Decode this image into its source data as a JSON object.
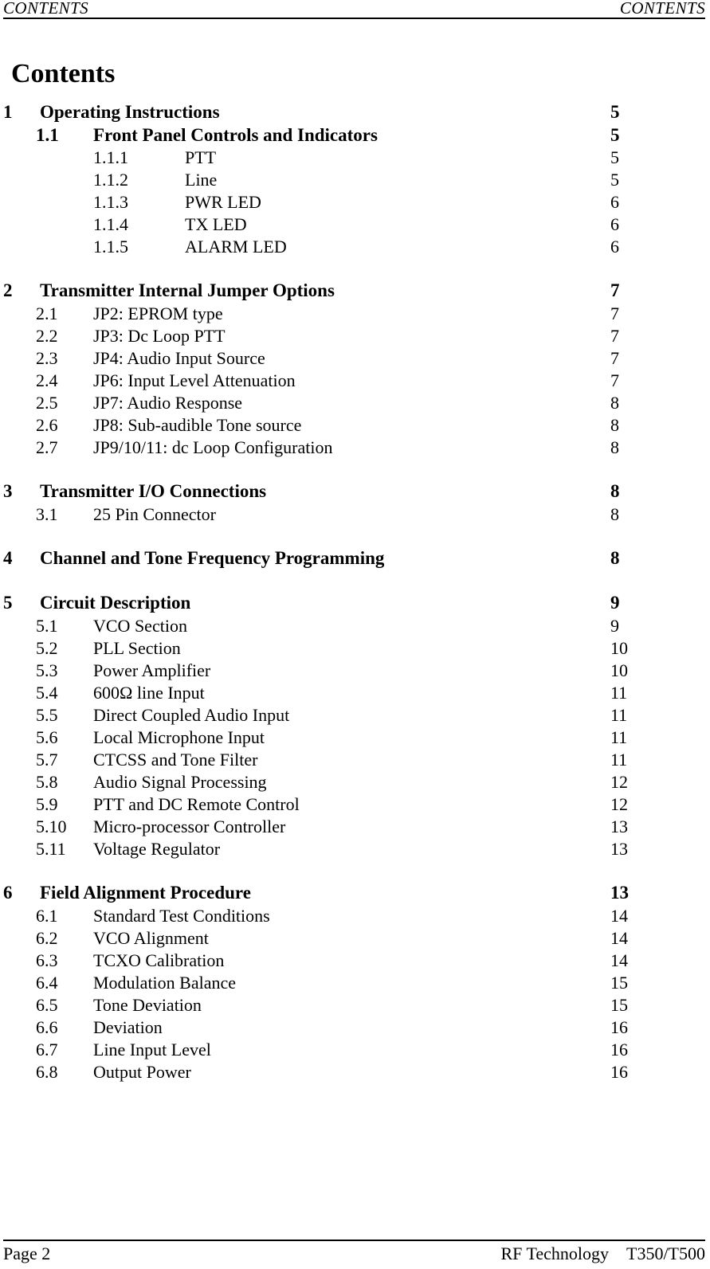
{
  "header": {
    "left": "CONTENTS",
    "right": "CONTENTS"
  },
  "title": "Contents",
  "toc": {
    "groups": [
      {
        "entries": [
          {
            "level": 1,
            "bold": true,
            "num": "1",
            "label": "Operating Instructions",
            "page": "5"
          },
          {
            "level": 2,
            "bold": true,
            "num": "1.1",
            "label": "Front Panel Controls and Indicators",
            "page": "5"
          },
          {
            "level": 3,
            "bold": false,
            "num": "1.1.1",
            "label": "PTT",
            "page": "5"
          },
          {
            "level": 3,
            "bold": false,
            "num": "1.1.2",
            "label": "Line",
            "page": "5"
          },
          {
            "level": 3,
            "bold": false,
            "num": "1.1.3",
            "label": "PWR LED",
            "page": "6"
          },
          {
            "level": 3,
            "bold": false,
            "num": "1.1.4",
            "label": "TX LED",
            "page": "6"
          },
          {
            "level": 3,
            "bold": false,
            "num": "1.1.5",
            "label": "ALARM LED",
            "page": "6"
          }
        ]
      },
      {
        "entries": [
          {
            "level": 1,
            "bold": true,
            "num": "2",
            "label": "Transmitter Internal Jumper Options",
            "page": "7"
          },
          {
            "level": 2,
            "bold": false,
            "num": "2.1",
            "label": "JP2:  EPROM type",
            "page": "7"
          },
          {
            "level": 2,
            "bold": false,
            "num": "2.2",
            "label": "JP3:  Dc Loop PTT",
            "page": "7"
          },
          {
            "level": 2,
            "bold": false,
            "num": "2.3",
            "label": "JP4:  Audio Input Source",
            "page": "7"
          },
          {
            "level": 2,
            "bold": false,
            "num": "2.4",
            "label": "JP6:  Input Level Attenuation",
            "page": "7"
          },
          {
            "level": 2,
            "bold": false,
            "num": "2.5",
            "label": "JP7:  Audio Response",
            "page": "8"
          },
          {
            "level": 2,
            "bold": false,
            "num": "2.6",
            "label": "JP8:  Sub-audible Tone source",
            "page": "8"
          },
          {
            "level": 2,
            "bold": false,
            "num": "2.7",
            "label": "JP9/10/11:  dc Loop Configuration",
            "page": "8"
          }
        ]
      },
      {
        "entries": [
          {
            "level": 1,
            "bold": true,
            "num": "3",
            "label": "Transmitter I/O Connections",
            "page": "8"
          },
          {
            "level": 2,
            "bold": false,
            "num": "3.1",
            "label": "25 Pin Connector",
            "page": "8"
          }
        ]
      },
      {
        "entries": [
          {
            "level": 1,
            "bold": true,
            "num": "4",
            "label": "Channel and Tone Frequency Programming",
            "page": "8"
          }
        ]
      },
      {
        "entries": [
          {
            "level": 1,
            "bold": true,
            "num": "5",
            "label": "Circuit Description",
            "page": "9"
          },
          {
            "level": 2,
            "bold": false,
            "num": "5.1",
            "label": "VCO Section",
            "page": "9"
          },
          {
            "level": 2,
            "bold": false,
            "num": "5.2",
            "label": "PLL Section",
            "page": "10"
          },
          {
            "level": 2,
            "bold": false,
            "num": "5.3",
            "label": "Power Amplifier",
            "page": "10"
          },
          {
            "level": 2,
            "bold": false,
            "num": "5.4",
            "label": "600Ω line Input",
            "page": "11"
          },
          {
            "level": 2,
            "bold": false,
            "num": "5.5",
            "label": "Direct Coupled Audio Input",
            "page": "11"
          },
          {
            "level": 2,
            "bold": false,
            "num": "5.6",
            "label": "Local Microphone Input",
            "page": "11"
          },
          {
            "level": 2,
            "bold": false,
            "num": "5.7",
            "label": "CTCSS and Tone Filter",
            "page": "11"
          },
          {
            "level": 2,
            "bold": false,
            "num": "5.8",
            "label": "Audio Signal Processing",
            "page": "12"
          },
          {
            "level": 2,
            "bold": false,
            "num": "5.9",
            "label": "PTT and DC Remote Control",
            "page": "12"
          },
          {
            "level": 2,
            "bold": false,
            "num": "5.10",
            "label": "Micro-processor Controller",
            "page": "13"
          },
          {
            "level": 2,
            "bold": false,
            "num": "5.11",
            "label": "Voltage Regulator",
            "page": "13"
          }
        ]
      },
      {
        "entries": [
          {
            "level": 1,
            "bold": true,
            "num": "6",
            "label": "Field Alignment Procedure",
            "page": "13"
          },
          {
            "level": 2,
            "bold": false,
            "num": "6.1",
            "label": "Standard Test Conditions",
            "page": "14"
          },
          {
            "level": 2,
            "bold": false,
            "num": "6.2",
            "label": "VCO Alignment",
            "page": "14"
          },
          {
            "level": 2,
            "bold": false,
            "num": "6.3",
            "label": "TCXO Calibration",
            "page": "14"
          },
          {
            "level": 2,
            "bold": false,
            "num": "6.4",
            "label": "Modulation Balance",
            "page": "15"
          },
          {
            "level": 2,
            "bold": false,
            "num": "6.5",
            "label": "Tone Deviation",
            "page": "15"
          },
          {
            "level": 2,
            "bold": false,
            "num": "6.6",
            "label": "Deviation",
            "page": "16"
          },
          {
            "level": 2,
            "bold": false,
            "num": "6.7",
            "label": "Line Input Level",
            "page": "16"
          },
          {
            "level": 2,
            "bold": false,
            "num": "6.8",
            "label": "Output Power",
            "page": "16"
          }
        ]
      }
    ]
  },
  "footer": {
    "page_label": "Page 2",
    "company": "RF Technology",
    "model": "T350/T500"
  }
}
